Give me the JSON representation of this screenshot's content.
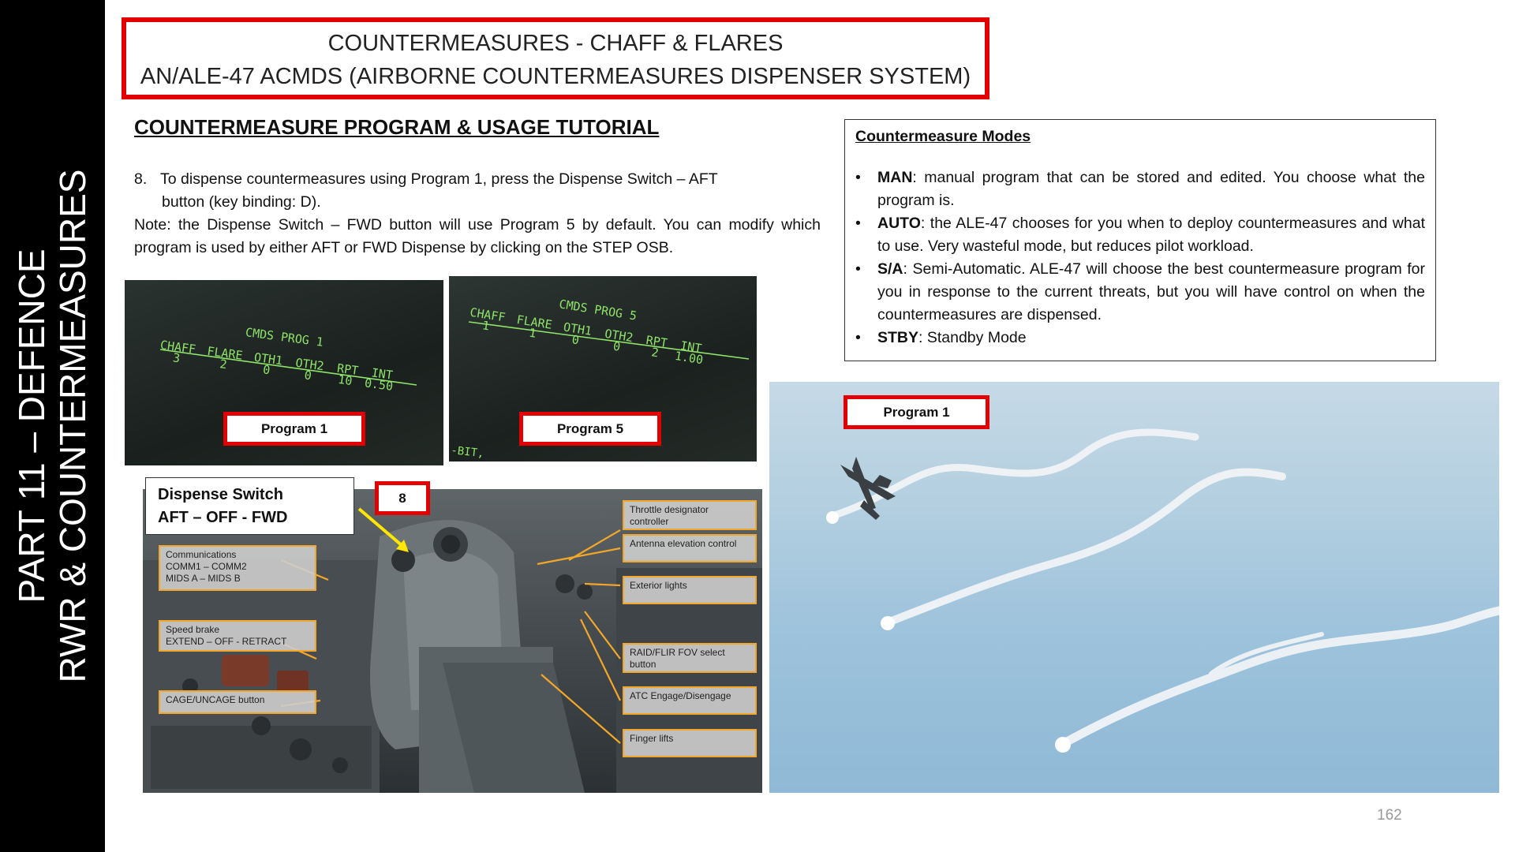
{
  "sidebar": {
    "line1": "PART 11 – DEFENCE",
    "line2": "RWR & COUNTERMEASURES"
  },
  "title": {
    "line1": "COUNTERMEASURES - CHAFF & FLARES",
    "line2": "AN/ALE-47 ACMDS (AIRBORNE COUNTERMEASURES DISPENSER SYSTEM)"
  },
  "section_heading": "COUNTERMEASURE PROGRAM & USAGE TUTORIAL",
  "step": {
    "number": "8.",
    "text_line1": "To dispense countermeasures using Program 1, press the Dispense Switch – AFT",
    "text_line2": "button (key binding: D)."
  },
  "note": "Note: the Dispense Switch – FWD button will use Program 5 by default. You can modify which program is used by either AFT or FWD Dispense by clicking on the STEP OSB.",
  "modes_box": {
    "title": "Countermeasure Modes",
    "items": [
      {
        "term": "MAN",
        "text": ": manual program that can be stored and edited. You choose what the program is."
      },
      {
        "term": "AUTO",
        "text": ": the ALE-47 chooses for you when to deploy countermeasures and what to use. Very wasteful mode, but reduces pilot workload."
      },
      {
        "term": "S/A",
        "text": ": Semi-Automatic. ALE-47 will choose the best countermeasure program for you in response to the current threats, but you will have control on when the countermeasures are dispensed."
      },
      {
        "term": "STBY",
        "text": ": Standby Mode"
      }
    ]
  },
  "mfd_program1": {
    "header": "CMDS PROG 1",
    "columns": [
      {
        "label": "CHAFF",
        "value": "3"
      },
      {
        "label": "FLARE",
        "value": "2"
      },
      {
        "label": "OTH1",
        "value": "0"
      },
      {
        "label": "OTH2",
        "value": "0"
      },
      {
        "label": "RPT",
        "value": "10"
      },
      {
        "label": "INT",
        "value": "0.50"
      }
    ],
    "caption": "Program 1"
  },
  "mfd_program5": {
    "header": "CMDS PROG 5",
    "columns": [
      {
        "label": "CHAFF",
        "value": "1"
      },
      {
        "label": "FLARE",
        "value": "1"
      },
      {
        "label": "OTH1",
        "value": "0"
      },
      {
        "label": "OTH2",
        "value": "0"
      },
      {
        "label": "RPT",
        "value": "2"
      },
      {
        "label": "INT",
        "value": "1.00"
      }
    ],
    "footer": "-BIT,",
    "caption": "Program 5"
  },
  "dispense_switch": {
    "line1": "Dispense Switch",
    "line2": "AFT – OFF - FWD"
  },
  "step_marker": "8",
  "cockpit_callouts": {
    "comms": [
      "Communications",
      "COMM1 – COMM2",
      "MIDS A – MIDS B"
    ],
    "speedbrake": [
      "Speed brake",
      "EXTEND – OFF - RETRACT"
    ],
    "cage": "CAGE/UNCAGE button",
    "throttle": [
      "Throttle designator",
      "controller"
    ],
    "antenna": "Antenna elevation control",
    "exterior": "Exterior lights",
    "raid": [
      "RAID/FLIR FOV select",
      "button"
    ],
    "atc": "ATC Engage/Disengage",
    "finger": "Finger lifts"
  },
  "photo_caption": "Program 1",
  "page_number": "162",
  "colors": {
    "red_frame": "#e30000",
    "callout_border": "#f2a72a",
    "mfd_green": "#8fe36a",
    "sidebar": "#000000"
  }
}
